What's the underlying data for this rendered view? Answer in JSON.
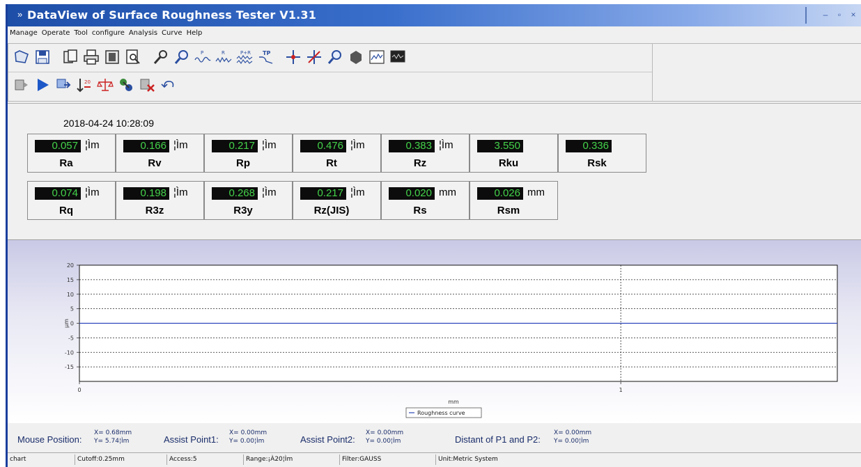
{
  "window": {
    "title": "DataView of Surface Roughness Tester  V1.31",
    "controls": [
      "–",
      "▫",
      "×"
    ]
  },
  "menu": [
    "Manage",
    "Operate",
    "Tool",
    "configure",
    "Analysis",
    "Curve",
    "Help"
  ],
  "toolbar": {
    "row1": [
      "open-icon",
      "save-icon",
      "copy-icon",
      "print-icon",
      "print-setup-icon",
      "print-preview-icon",
      "tool-icon",
      "search-icon",
      "p-profile-icon",
      "r-profile-icon",
      "pr-profile-icon",
      "tp-curve-icon",
      "crosshair-icon",
      "assist-point-icon",
      "zoom-icon",
      "block-icon",
      "graph-icon",
      "monitor-icon"
    ],
    "row2": [
      "measure-icon",
      "start-icon",
      "transfer-icon",
      "sort-icon",
      "calibrate-icon",
      "connect-icon",
      "delete-icon",
      "undo-icon"
    ],
    "tp_label": "TP"
  },
  "results": {
    "timestamp": "2018-04-24 10:28:09",
    "row1": [
      {
        "name": "Ra",
        "value": "0.057",
        "unit": "¦Ìm"
      },
      {
        "name": "Rv",
        "value": "0.166",
        "unit": "¦Ìm"
      },
      {
        "name": "Rp",
        "value": "0.217",
        "unit": "¦Ìm"
      },
      {
        "name": "Rt",
        "value": "0.476",
        "unit": "¦Ìm"
      },
      {
        "name": "Rz",
        "value": "0.383",
        "unit": "¦Ìm"
      },
      {
        "name": "Rku",
        "value": "3.550",
        "unit": ""
      },
      {
        "name": "Rsk",
        "value": "0.336",
        "unit": ""
      }
    ],
    "row2": [
      {
        "name": "Rq",
        "value": "0.074",
        "unit": "¦Ìm"
      },
      {
        "name": "R3z",
        "value": "0.198",
        "unit": "¦Ìm"
      },
      {
        "name": "R3y",
        "value": "0.268",
        "unit": "¦Ìm"
      },
      {
        "name": "Rz(JIS)",
        "value": "0.217",
        "unit": "¦Ìm"
      },
      {
        "name": "Rs",
        "value": "0.020",
        "unit": "mm"
      },
      {
        "name": "Rsm",
        "value": "0.026",
        "unit": "mm"
      }
    ]
  },
  "chart_data": {
    "type": "line",
    "xlabel": "mm",
    "ylabel": "μm",
    "xlim": [
      0,
      1.4
    ],
    "ylim": [
      -20,
      20
    ],
    "x_ticks": [
      0,
      1
    ],
    "y_ticks": [
      20,
      15,
      10,
      5,
      0,
      -5,
      -10,
      -15
    ],
    "grid": true,
    "legend_position": "bottom-center",
    "series": [
      {
        "name": "Roughness curve",
        "color": "#2b45b8",
        "x": [
          0,
          0.2,
          0.4,
          0.6,
          0.8,
          1.0,
          1.2,
          1.4
        ],
        "y": [
          0,
          0,
          0,
          0,
          0,
          0,
          0,
          0
        ]
      }
    ]
  },
  "info": {
    "mouse_label": "Mouse Position:",
    "mouse_x": "X=  0.68mm",
    "mouse_y": "Y=  5.74¦Ìm",
    "assist1_label": "Assist Point1:",
    "assist1_x": "X=  0.00mm",
    "assist1_y": "Y=  0.00¦Ìm",
    "assist2_label": "Assist Point2:",
    "assist2_x": "X=  0.00mm",
    "assist2_y": "Y=  0.00¦Ìm",
    "distant_label": "Distant of P1 and P2:",
    "distant_x": "X=  0.00mm",
    "distant_y": "Y=  0.00¦Ìm"
  },
  "status": {
    "mode": "chart",
    "cutoff": "Cutoff:0.25mm",
    "access": "Access:5",
    "range": "Range:¡À20¦Ìm",
    "filter": "Filter:GAUSS",
    "unit": "Unit:Metric System"
  },
  "colors": {
    "display_bg": "#0c0c0c",
    "display_fg": "#43d24a",
    "titlebar": "#1d4ea8",
    "curve": "#2b45b8"
  }
}
